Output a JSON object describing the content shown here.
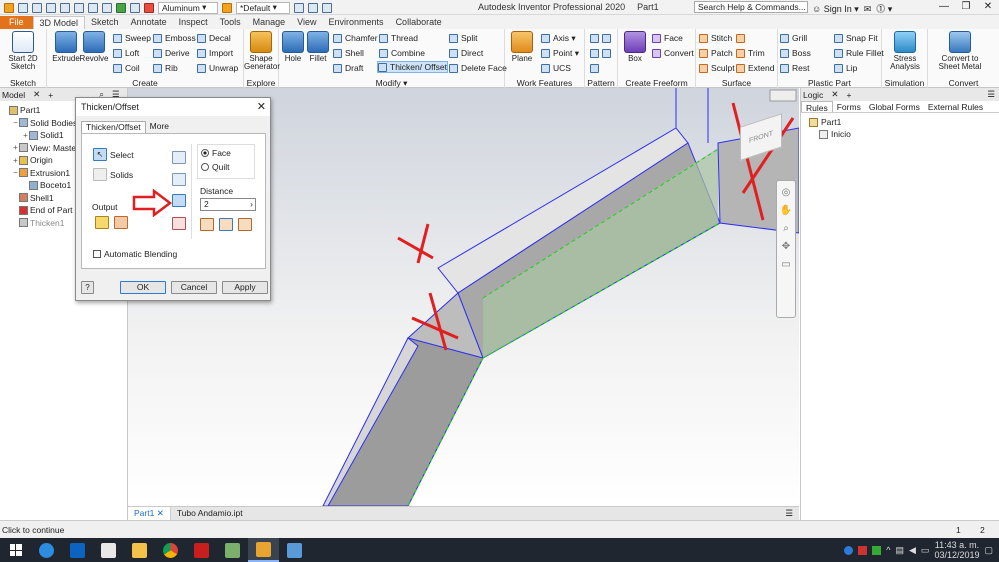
{
  "qat": {
    "material": "Aluminum",
    "appearance": "*Default"
  },
  "titlebar": {
    "app": "Autodesk Inventor Professional 2020",
    "doc": "Part1",
    "search_placeholder": "Search Help & Commands...",
    "signin": "Sign In"
  },
  "tabs": [
    "File",
    "3D Model",
    "Sketch",
    "Annotate",
    "Inspect",
    "Tools",
    "Manage",
    "View",
    "Environments",
    "Collaborate"
  ],
  "ribbon": {
    "sketch": {
      "label": "Sketch",
      "start": "Start 2D Sketch"
    },
    "create": {
      "label": "Create",
      "extrude": "Extrude",
      "revolve": "Revolve",
      "sweep": "Sweep",
      "loft": "Loft",
      "coil": "Coil",
      "emboss": "Emboss",
      "derive": "Derive",
      "rib": "Rib",
      "decal": "Decal",
      "import": "Import",
      "unwrap": "Unwrap"
    },
    "explore": {
      "label": "Explore",
      "shape": "Shape Generator"
    },
    "modify": {
      "label": "Modify",
      "hole": "Hole",
      "fillet": "Fillet",
      "chamfer": "Chamfer",
      "shell": "Shell",
      "draft": "Draft",
      "thread": "Thread",
      "combine": "Combine",
      "thicken": "Thicken/ Offset",
      "split": "Split",
      "direct": "Direct",
      "deleteface": "Delete Face"
    },
    "work": {
      "label": "Work Features",
      "plane": "Plane",
      "axis": "Axis",
      "point": "Point",
      "ucs": "UCS"
    },
    "pattern": {
      "label": "Pattern"
    },
    "freeform": {
      "label": "Create Freeform",
      "box": "Box",
      "face": "Face",
      "convert": "Convert"
    },
    "surface": {
      "label": "Surface",
      "stitch": "Stitch",
      "patch": "Patch",
      "sculpt": "Sculpt",
      "trim": "Trim",
      "extend": "Extend"
    },
    "plastic": {
      "label": "Plastic Part",
      "grill": "Grill",
      "boss": "Boss",
      "rest": "Rest",
      "snapfit": "Snap Fit",
      "rulefillet": "Rule Fillet",
      "lip": "Lip"
    },
    "simulation": {
      "label": "Simulation",
      "stress": "Stress Analysis"
    },
    "convert": {
      "label": "Convert",
      "sheet": "Convert to Sheet Metal"
    }
  },
  "model_browser": {
    "title": "Model",
    "items": [
      {
        "label": "Part1",
        "indent": 0,
        "toggle": ""
      },
      {
        "label": "Solid Bodies(1)",
        "indent": 1,
        "toggle": "−"
      },
      {
        "label": "Solid1",
        "indent": 2,
        "toggle": "+"
      },
      {
        "label": "View: Master",
        "indent": 1,
        "toggle": "+"
      },
      {
        "label": "Origin",
        "indent": 1,
        "toggle": "+"
      },
      {
        "label": "Extrusion1",
        "indent": 1,
        "toggle": "−"
      },
      {
        "label": "Boceto1",
        "indent": 2,
        "toggle": ""
      },
      {
        "label": "Shell1",
        "indent": 1,
        "toggle": ""
      },
      {
        "label": "End of Part",
        "indent": 1,
        "toggle": ""
      },
      {
        "label": "Thicken1",
        "indent": 1,
        "toggle": ""
      }
    ]
  },
  "dialog": {
    "title": "Thicken/Offset",
    "tabs": [
      "Thicken/Offset",
      "More"
    ],
    "select": "Select",
    "solids": "Solids",
    "output": "Output",
    "face": "Face",
    "quilt": "Quilt",
    "distance_label": "Distance",
    "distance": "2",
    "auto_blend": "Automatic Blending",
    "ok": "OK",
    "cancel": "Cancel",
    "apply": "Apply"
  },
  "viewcube": {
    "label": "FRONT"
  },
  "logic": {
    "title": "Logic",
    "tabs": [
      "Rules",
      "Forms",
      "Global Forms",
      "External Rules"
    ],
    "items": [
      "Part1",
      "Inicio"
    ]
  },
  "documents": [
    "Part1",
    "Tubo Andamio.ipt"
  ],
  "status": {
    "text": "Click to continue",
    "count1": "1",
    "count2": "2"
  },
  "clock": {
    "time": "11:43 a. m.",
    "date": "03/12/2019"
  },
  "colors": {
    "accent": "#e2731b",
    "selection": "#2e2ef0",
    "annotation": "#e02020"
  }
}
